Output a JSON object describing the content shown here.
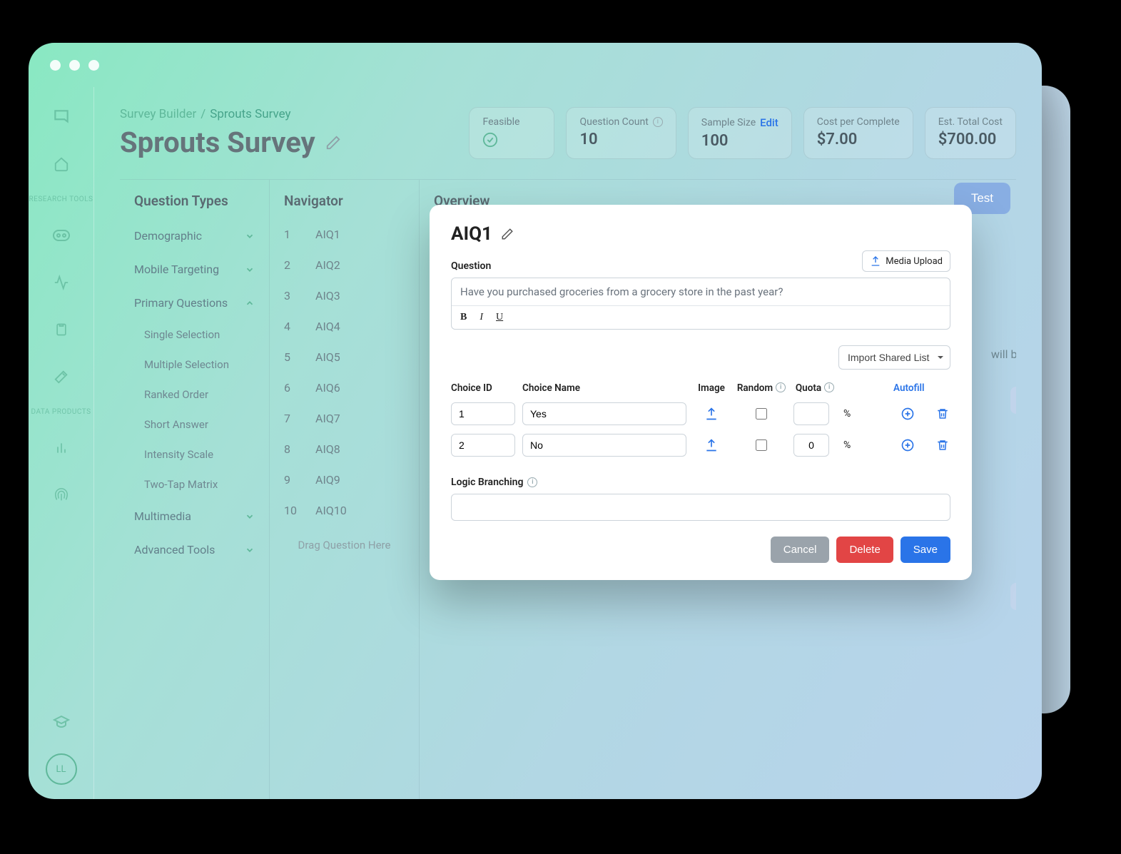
{
  "breadcrumb": {
    "root": "Survey Builder",
    "sep": "/",
    "current": "Sprouts Survey"
  },
  "page_title": "Sprouts Survey",
  "metrics": {
    "feasible": {
      "label": "Feasible"
    },
    "question_count": {
      "label": "Question Count",
      "value": "10"
    },
    "sample_size": {
      "label": "Sample Size",
      "value": "100",
      "edit": "Edit"
    },
    "cpc": {
      "label": "Cost per Complete",
      "value": "$7.00"
    },
    "total": {
      "label": "Est. Total Cost",
      "value": "$700.00"
    }
  },
  "leftnav": {
    "section_research": "RESEARCH TOOLS",
    "section_data": "DATA PRODUCTS",
    "avatar": "LL"
  },
  "qtypes": {
    "title": "Question Types",
    "groups": [
      {
        "label": "Demographic",
        "open": false
      },
      {
        "label": "Mobile Targeting",
        "open": false
      },
      {
        "label": "Primary Questions",
        "open": true,
        "children": [
          "Single Selection",
          "Multiple Selection",
          "Ranked Order",
          "Short Answer",
          "Intensity Scale",
          "Two-Tap Matrix"
        ]
      },
      {
        "label": "Multimedia",
        "open": false
      },
      {
        "label": "Advanced Tools",
        "open": false
      }
    ]
  },
  "navigator": {
    "title": "Navigator",
    "items": [
      "AIQ1",
      "AIQ2",
      "AIQ3",
      "AIQ4",
      "AIQ5",
      "AIQ6",
      "AIQ7",
      "AIQ8",
      "AIQ9",
      "AIQ10"
    ],
    "drag": "Drag Question Here"
  },
  "overview": {
    "title": "Overview",
    "test": "Test",
    "body_fragment": "will be"
  },
  "modal": {
    "title": "AIQ1",
    "question_label": "Question",
    "media_upload": "Media Upload",
    "question_text": "Have you purchased groceries from a grocery store in the past year?",
    "import_list": "Import Shared List",
    "columns": {
      "id": "Choice ID",
      "name": "Choice Name",
      "image": "Image",
      "random": "Random",
      "quota": "Quota",
      "autofill": "Autofill"
    },
    "choices": [
      {
        "id": "1",
        "name": "Yes",
        "quota": ""
      },
      {
        "id": "2",
        "name": "No",
        "quota": "0"
      }
    ],
    "pct": "%",
    "logic_label": "Logic Branching",
    "buttons": {
      "cancel": "Cancel",
      "delete": "Delete",
      "save": "Save"
    }
  }
}
